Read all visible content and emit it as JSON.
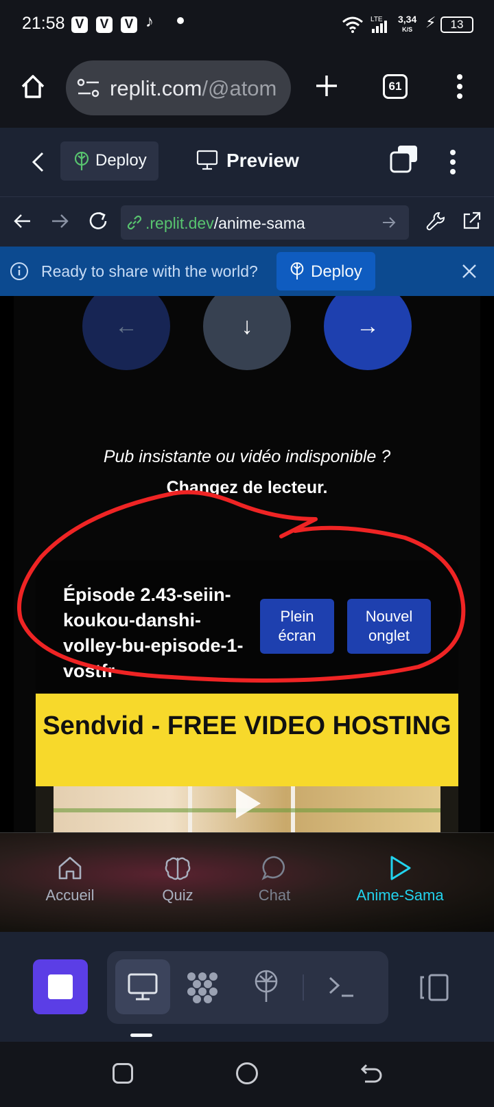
{
  "status_bar": {
    "time": "21:58",
    "app_badges": [
      "V",
      "V",
      "V"
    ],
    "net_speed_value": "3,34",
    "net_speed_unit": "K/S",
    "battery": "13"
  },
  "browser": {
    "url_host": "replit.com",
    "url_path": "/@atom",
    "tab_count": "61"
  },
  "replit_header": {
    "deploy_label": "Deploy",
    "preview_label": "Preview"
  },
  "replit_nav": {
    "url_domain": ".replit.dev",
    "url_path": "/anime-sama"
  },
  "banner": {
    "message": "Ready to share with the world?",
    "deploy_label": "Deploy"
  },
  "page": {
    "nav_buttons": {
      "prev": "←",
      "down": "↓",
      "next": "→"
    },
    "notice_line1": "Pub insistante ou vidéo indisponible ?",
    "notice_line2": "Changez de lecteur.",
    "episode_title": "Épisode 2.43-seiin-koukou-danshi-volley-bu-episode-1-vostfr",
    "fullscreen_label_1": "Plein",
    "fullscreen_label_2": "écran",
    "newtab_label_1": "Nouvel",
    "newtab_label_2": "onglet",
    "video_banner": "Sendvid - FREE VIDEO HOSTING"
  },
  "app_nav": {
    "items": [
      {
        "label": "Accueil",
        "icon": "home-icon",
        "color": "#a9b0bf"
      },
      {
        "label": "Quiz",
        "icon": "brain-icon",
        "color": "#a9b0bf"
      },
      {
        "label": "Chat",
        "icon": "chat-bubble-icon",
        "color": "#7b8290"
      },
      {
        "label": "Anime-Sama",
        "icon": "play-icon",
        "color": "#22d3ee"
      }
    ]
  },
  "colors": {
    "accent_blue": "#1e40af",
    "replit_bg": "#1c2333",
    "banner_bg": "#0c4a90",
    "stop_purple": "#5b3ee6",
    "active_cyan": "#22d3ee"
  }
}
